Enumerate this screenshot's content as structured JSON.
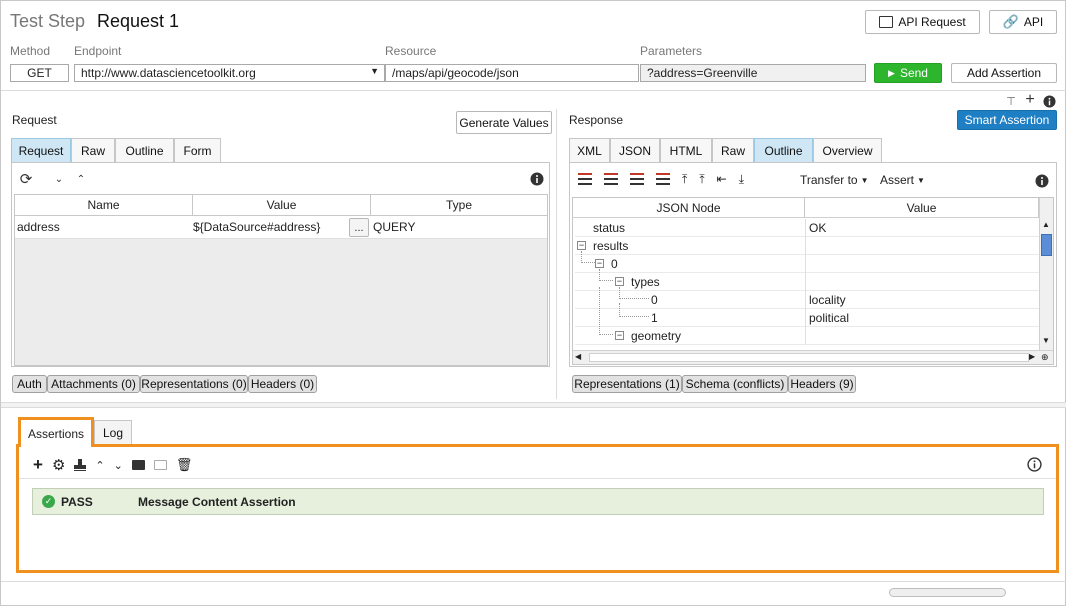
{
  "header": {
    "title_prefix": "Test Step",
    "title": "Request 1",
    "api_request_label": "API Request",
    "api_label": "API"
  },
  "request_bar": {
    "method_label": "Method",
    "endpoint_label": "Endpoint",
    "resource_label": "Resource",
    "parameters_label": "Parameters",
    "method": "GET",
    "endpoint": "http://www.datasciencetoolkit.org",
    "resource": "/maps/api/geocode/json",
    "parameters": "?address=Greenville",
    "send_label": "Send",
    "add_assertion_label": "Add Assertion"
  },
  "request_panel": {
    "title": "Request",
    "generate_values_label": "Generate Values",
    "tabs": [
      "Request",
      "Raw",
      "Outline",
      "Form"
    ],
    "active_tab": "Request",
    "table": {
      "columns": [
        "Name",
        "Value",
        "Type"
      ],
      "rows": [
        {
          "name": "address",
          "value": "${DataSource#address}",
          "ellipsis": "...",
          "type": "QUERY"
        }
      ]
    },
    "bottom_tabs": [
      "Auth",
      "Attachments (0)",
      "Representations (0)",
      "Headers (0)"
    ]
  },
  "response_panel": {
    "title": "Response",
    "smart_assertion_label": "Smart Assertion",
    "tabs": [
      "XML",
      "JSON",
      "HTML",
      "Raw",
      "Outline",
      "Overview"
    ],
    "active_tab": "Outline",
    "transfer_to_label": "Transfer to",
    "assert_label": "Assert",
    "tree_columns": [
      "JSON Node",
      "Value"
    ],
    "tree_rows": [
      {
        "node": "status",
        "value": "OK"
      },
      {
        "node": "results",
        "value": ""
      },
      {
        "node": "0",
        "value": ""
      },
      {
        "node": "types",
        "value": ""
      },
      {
        "node": "0",
        "value": "locality"
      },
      {
        "node": "1",
        "value": "political"
      },
      {
        "node": "geometry",
        "value": ""
      }
    ],
    "bottom_tabs": [
      "Representations (1)",
      "Schema (conflicts)",
      "Headers (9)"
    ]
  },
  "assertions_panel": {
    "tabs": [
      "Assertions",
      "Log"
    ],
    "active_tab": "Assertions",
    "items": [
      {
        "status": "PASS",
        "name": "Message Content Assertion"
      }
    ],
    "colors": {
      "highlight": "#f0901e",
      "pass_bg": "#e6f0dc",
      "pass_icon": "#3aa84a"
    }
  },
  "colors": {
    "send": "#2db52d",
    "smart_assertion": "#1f7fc4",
    "active_tab": "#cfe7f5"
  }
}
